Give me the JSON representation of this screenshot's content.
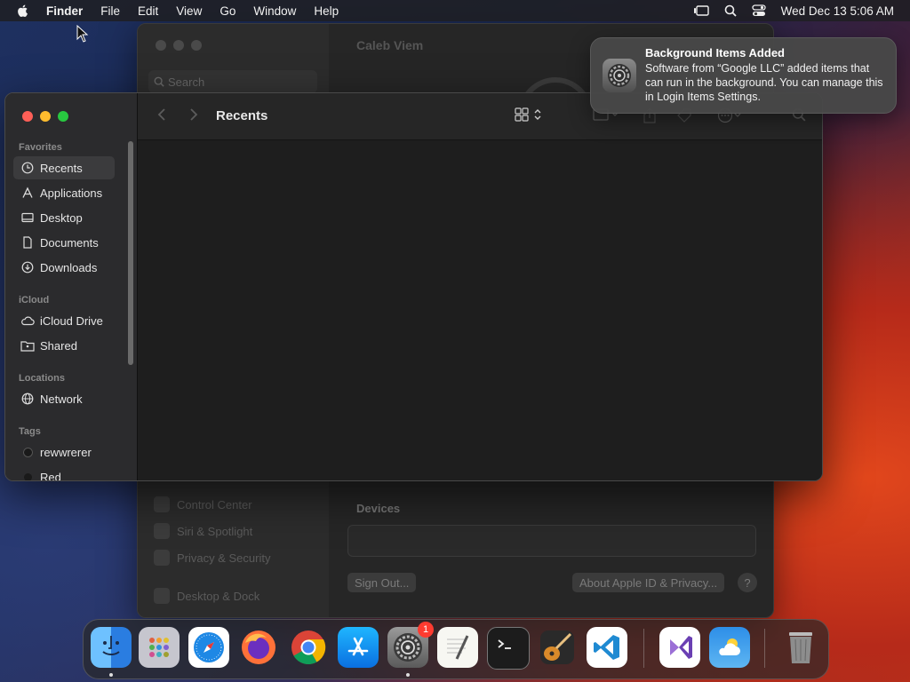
{
  "menubar": {
    "app_name": "Finder",
    "items": [
      "File",
      "Edit",
      "View",
      "Go",
      "Window",
      "Help"
    ],
    "clock": "Wed Dec 13  5:06 AM"
  },
  "settings_window": {
    "title": "Caleb Viem",
    "search_placeholder": "Search",
    "sidebar_items": [
      "Control Center",
      "Siri & Spotlight",
      "Privacy & Security",
      "Desktop & Dock"
    ],
    "devices_label": "Devices",
    "sign_out_label": "Sign Out...",
    "about_label": "About Apple ID & Privacy...",
    "help_label": "?"
  },
  "finder": {
    "title": "Recents",
    "sections": {
      "favorites": "Favorites",
      "icloud": "iCloud",
      "locations": "Locations",
      "tags": "Tags"
    },
    "favorites": [
      "Recents",
      "Applications",
      "Desktop",
      "Documents",
      "Downloads"
    ],
    "icloud_items": [
      "iCloud Drive",
      "Shared"
    ],
    "locations": [
      "Network"
    ],
    "tags": [
      {
        "label": "rewwrerer",
        "color": "#1a1a1a"
      },
      {
        "label": "Red",
        "color": "#ff453a"
      }
    ]
  },
  "notification": {
    "title": "Background Items Added",
    "body": "Software from “Google LLC” added items that can run in the background. You can manage this in Login Items Settings."
  },
  "dock": {
    "apps": [
      "Finder",
      "Launchpad",
      "Safari",
      "Firefox",
      "Chrome",
      "App Store",
      "System Settings",
      "TextEdit",
      "Terminal",
      "GarageBand",
      "Visual Studio Code",
      "Visual Studio",
      "Weather",
      "Trash"
    ],
    "badge_count": "1"
  }
}
